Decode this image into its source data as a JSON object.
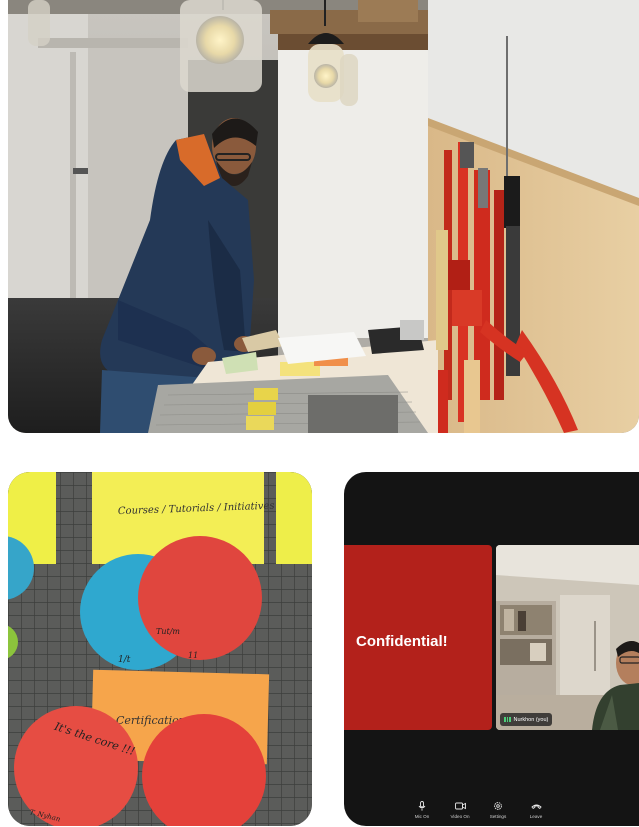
{
  "board": {
    "sticky_top_text": "Courses / Tutorials / Initiatives",
    "circle_blue_text": "1/t",
    "circle_red_top_text": "Tut/m",
    "circle_red_top_mark": "11",
    "orange_note_text": "Certification",
    "circle_red_bottom_text": "It's the core !!!",
    "circle_red_bottom_sig": "T. Nyhan"
  },
  "call": {
    "shared_screen_text": "Confidential!",
    "participant_name": "Nurkhon (you)",
    "controls": [
      {
        "label": "Mic On",
        "icon": "mic-icon"
      },
      {
        "label": "Video On",
        "icon": "video-icon"
      },
      {
        "label": "Settings",
        "icon": "gear-icon"
      },
      {
        "label": "Leave",
        "icon": "phone-hangup-icon"
      }
    ],
    "colors": {
      "background": "#141414",
      "share_tile": "#b3211b",
      "audio_indicator": "#4cd07a"
    }
  }
}
